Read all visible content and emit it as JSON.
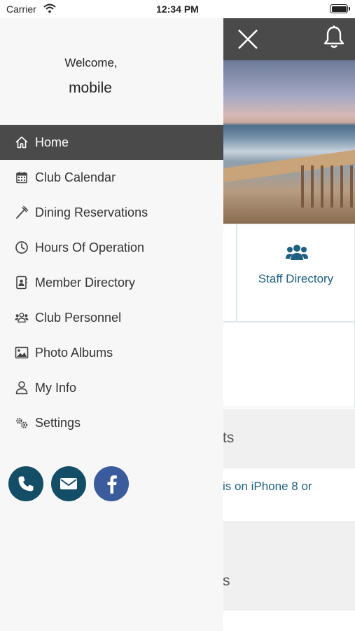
{
  "status": {
    "carrier": "Carrier",
    "time": "12:34 PM"
  },
  "drawer": {
    "welcome": "Welcome,",
    "username": "mobile",
    "items": [
      {
        "label": "Home",
        "icon": "home-icon",
        "active": true
      },
      {
        "label": "Club Calendar",
        "icon": "calendar-icon",
        "active": false
      },
      {
        "label": "Dining Reservations",
        "icon": "dining-icon",
        "active": false
      },
      {
        "label": "Hours Of Operation",
        "icon": "clock-icon",
        "active": false
      },
      {
        "label": "Member Directory",
        "icon": "contact-book-icon",
        "active": false
      },
      {
        "label": "Club Personnel",
        "icon": "people-icon",
        "active": false
      },
      {
        "label": "Photo Albums",
        "icon": "image-icon",
        "active": false
      },
      {
        "label": "My Info",
        "icon": "user-icon",
        "active": false
      },
      {
        "label": "Settings",
        "icon": "gears-icon",
        "active": false
      }
    ],
    "socials": [
      "phone-icon",
      "mail-icon",
      "facebook-icon"
    ]
  },
  "background": {
    "staff_directory": "Staff Directory",
    "section_a_fragment": "ts",
    "link_fragment": "is on iPhone 8 or",
    "section_b_fragment": "s"
  },
  "colors": {
    "header": "#4a4a4a",
    "drawer_bg": "#f7f7f7",
    "active_item": "#4a4a4a",
    "social_dark": "#144e66",
    "facebook": "#3b5c9c",
    "link": "#1f5f80"
  }
}
